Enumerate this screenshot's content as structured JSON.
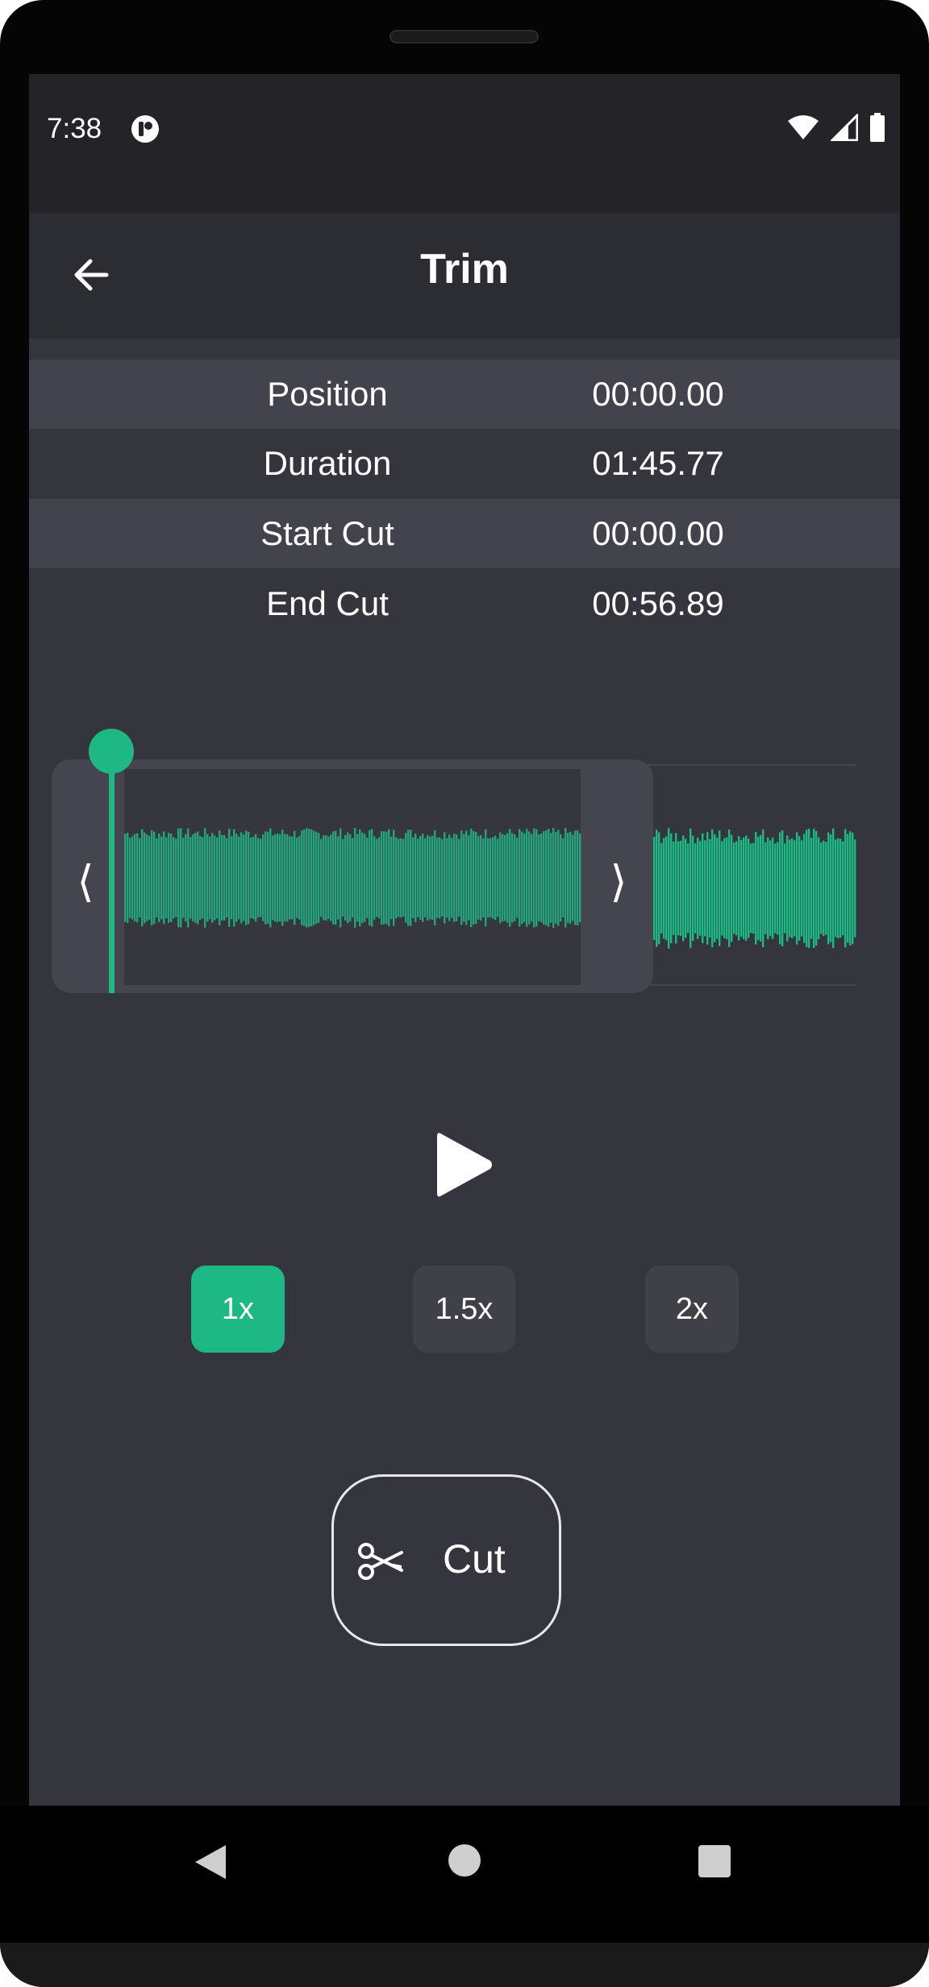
{
  "status_bar": {
    "time": "7:38"
  },
  "app_bar": {
    "title": "Trim"
  },
  "info": [
    {
      "label": "Position",
      "value": "00:00.00"
    },
    {
      "label": "Duration",
      "value": "01:45.77"
    },
    {
      "label": "Start Cut",
      "value": "00:00.00"
    },
    {
      "label": "End Cut",
      "value": "00:56.89"
    }
  ],
  "waveform": {
    "left_handle": "⟨",
    "right_handle": "⟩",
    "accent_color": "#1db884",
    "selected_color": "#27a37c"
  },
  "speeds": [
    {
      "label": "1x",
      "active": true
    },
    {
      "label": "1.5x",
      "active": false
    },
    {
      "label": "2x",
      "active": false
    }
  ],
  "cut_button": {
    "label": "Cut",
    "icon": "scissors-icon"
  },
  "nav": {
    "back": "back-triangle-icon",
    "home": "home-circle-icon",
    "recents": "recents-square-icon"
  }
}
